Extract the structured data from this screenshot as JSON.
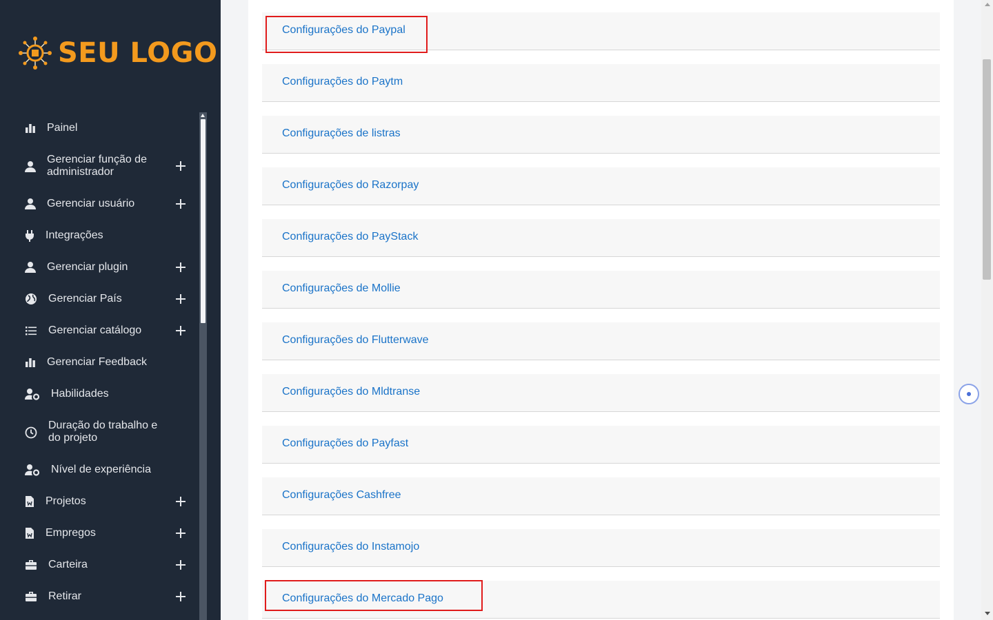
{
  "brand": {
    "logo_text": "SEU LOGO",
    "accent": "#f39a1e"
  },
  "sidebar": {
    "items": [
      {
        "label": "Painel",
        "icon": "bar-chart-icon",
        "expandable": false
      },
      {
        "label": "Gerenciar função de administrador",
        "icon": "user-icon",
        "expandable": true
      },
      {
        "label": "Gerenciar usuário",
        "icon": "user-icon",
        "expandable": true
      },
      {
        "label": "Integrações",
        "icon": "plug-icon",
        "expandable": false
      },
      {
        "label": "Gerenciar plugin",
        "icon": "user-icon",
        "expandable": true
      },
      {
        "label": "Gerenciar País",
        "icon": "globe-icon",
        "expandable": true
      },
      {
        "label": "Gerenciar catálogo",
        "icon": "list-icon",
        "expandable": true
      },
      {
        "label": "Gerenciar Feedback",
        "icon": "bar-chart-icon",
        "expandable": false
      },
      {
        "label": "Habilidades",
        "icon": "user-gear-icon",
        "expandable": false
      },
      {
        "label": "Duração do trabalho e do projeto",
        "icon": "clock-icon",
        "expandable": false
      },
      {
        "label": "Nível de experiência",
        "icon": "user-gear-icon",
        "expandable": false
      },
      {
        "label": "Projetos",
        "icon": "file-icon",
        "expandable": true
      },
      {
        "label": "Empregos",
        "icon": "file-icon",
        "expandable": true
      },
      {
        "label": "Carteira",
        "icon": "briefcase-icon",
        "expandable": true
      },
      {
        "label": "Retirar",
        "icon": "briefcase-icon",
        "expandable": true
      }
    ]
  },
  "settings": {
    "items": [
      {
        "label": "Configurações do Paypal",
        "highlighted": true
      },
      {
        "label": "Configurações do Paytm",
        "highlighted": false
      },
      {
        "label": "Configurações de listras",
        "highlighted": false
      },
      {
        "label": "Configurações do Razorpay",
        "highlighted": false
      },
      {
        "label": "Configurações do PayStack",
        "highlighted": false
      },
      {
        "label": "Configurações de Mollie",
        "highlighted": false
      },
      {
        "label": "Configurações do Flutterwave",
        "highlighted": false
      },
      {
        "label": "Configurações do Mldtranse",
        "highlighted": false
      },
      {
        "label": "Configurações do Payfast",
        "highlighted": false
      },
      {
        "label": "Configurações Cashfree",
        "highlighted": false
      },
      {
        "label": "Configurações do Instamojo",
        "highlighted": false
      },
      {
        "label": "Configurações do Mercado Pago",
        "highlighted": true
      }
    ],
    "link_color": "#1a73c8",
    "highlight_color": "#e01b1b"
  }
}
